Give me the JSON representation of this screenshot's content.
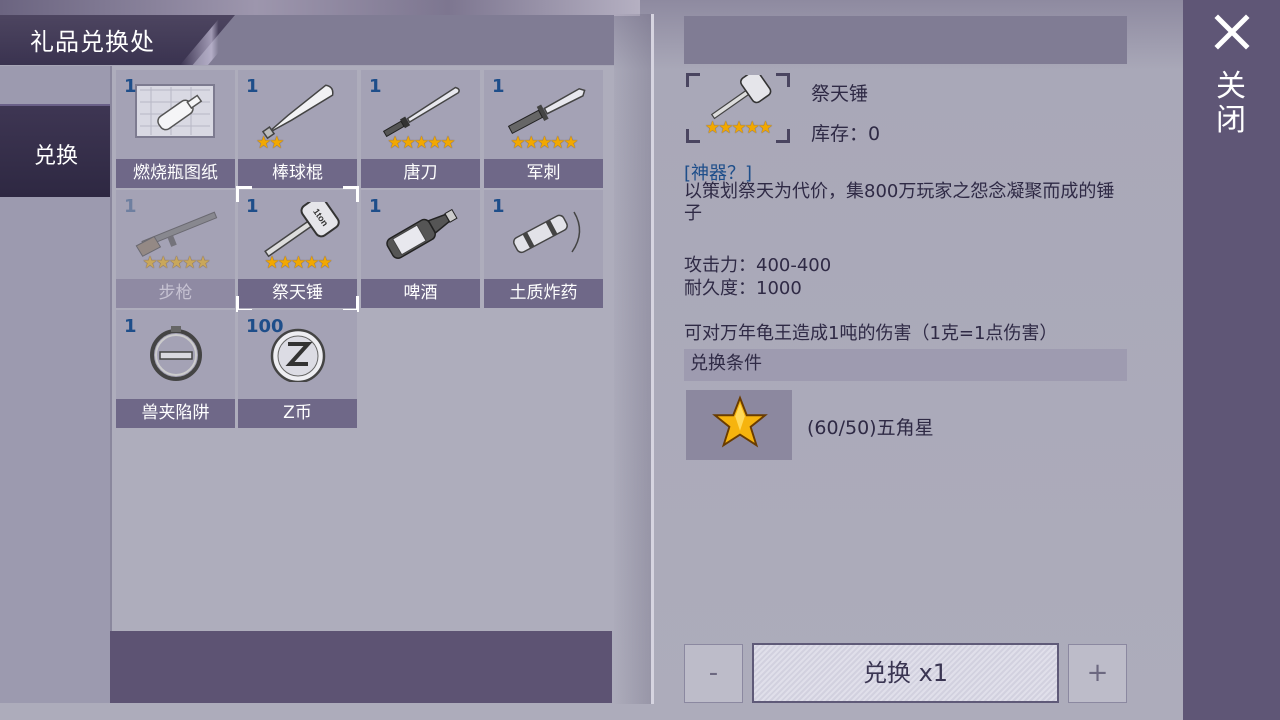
{
  "header": {
    "title": "礼品兑换处"
  },
  "sidebar": {
    "tabs": [
      {
        "label": "兑换"
      }
    ]
  },
  "items": [
    {
      "count": "1",
      "name": "燃烧瓶图纸",
      "stars": "",
      "icon": "blueprint-icon"
    },
    {
      "count": "1",
      "name": "棒球棍",
      "stars": "★★",
      "icon": "baseball-bat-icon"
    },
    {
      "count": "1",
      "name": "唐刀",
      "stars": "★★★★★",
      "icon": "katana-icon"
    },
    {
      "count": "1",
      "name": "军刺",
      "stars": "★★★★★",
      "icon": "bayonet-icon"
    },
    {
      "count": "1",
      "name": "步枪",
      "stars": "★★★★★",
      "icon": "rifle-icon",
      "disabled": true
    },
    {
      "count": "1",
      "name": "祭天锤",
      "stars": "★★★★★",
      "icon": "hammer-icon",
      "selected": true
    },
    {
      "count": "1",
      "name": "啤酒",
      "stars": "",
      "icon": "beer-bottle-icon"
    },
    {
      "count": "1",
      "name": "土质炸药",
      "stars": "",
      "icon": "dynamite-icon"
    },
    {
      "count": "1",
      "name": "兽夹陷阱",
      "stars": "",
      "icon": "bear-trap-icon"
    },
    {
      "count": "100",
      "name": "Z币",
      "stars": "",
      "icon": "z-coin-icon"
    }
  ],
  "detail": {
    "name": "祭天锤",
    "stars": "★★★★★",
    "stock": "库存：0",
    "tag": "[神器？]",
    "description": "以策划祭天为代价，集800万玩家之怨念凝聚而成的锤子",
    "attack": "攻击力：400-400",
    "durability": "耐久度：1000",
    "note": "可对万年龟王造成1吨的伤害（1克=1点伤害）",
    "icon": "hammer-icon"
  },
  "condition": {
    "header": "兑换条件",
    "icon": "star-icon",
    "text": "(60/50)五角星"
  },
  "actions": {
    "minus": "-",
    "exchange": "兑换 x1",
    "plus": "+"
  },
  "close": {
    "label": "关闭",
    "icon": "close-icon"
  }
}
